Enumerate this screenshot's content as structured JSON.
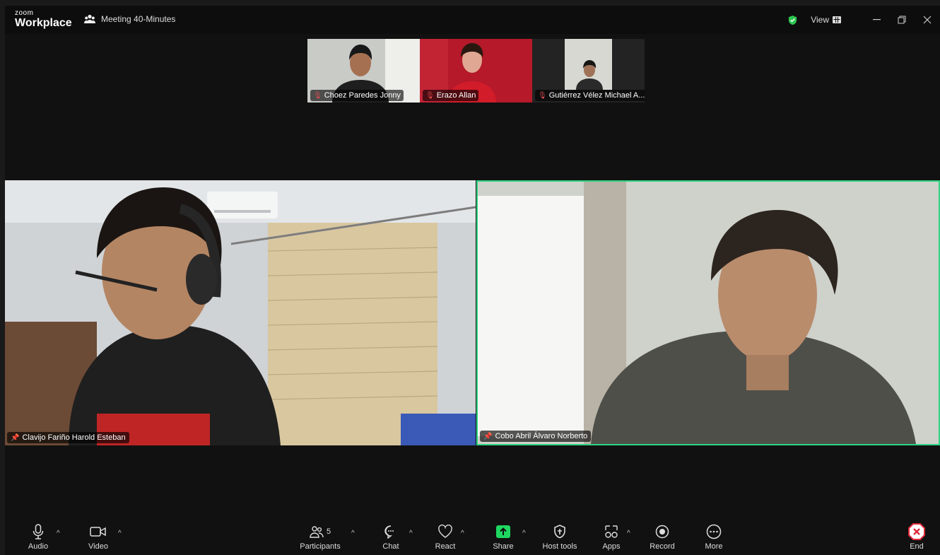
{
  "app": {
    "logo_top": "zoom",
    "logo_bottom": "Workplace",
    "meeting_title": "Meeting 40-Minutes"
  },
  "titlebar": {
    "view_label": "View"
  },
  "thumbnails": [
    {
      "name": "Choez Paredes Jonny",
      "muted": true
    },
    {
      "name": "Erazo Allan",
      "muted": true
    },
    {
      "name": "Gutiérrez Vélez Michael A...",
      "muted": true
    }
  ],
  "tiles": [
    {
      "name": "Clavijo Fariño Harold Esteban",
      "pinned": true
    },
    {
      "name": "Cobo Abril Álvaro Norberto",
      "pinned": true,
      "active_speaker": true
    }
  ],
  "toolbar": {
    "audio": "Audio",
    "video": "Video",
    "participants": "Participants",
    "participants_count": "5",
    "chat": "Chat",
    "react": "React",
    "share": "Share",
    "host_tools": "Host tools",
    "apps": "Apps",
    "record": "Record",
    "more": "More",
    "end": "End"
  },
  "colors": {
    "active_speaker_border": "#2fd381",
    "share_green": "#1ed760",
    "end_red": "#e02a3a",
    "muted_red": "#e24c4c",
    "shield_green": "#2ec44f"
  }
}
